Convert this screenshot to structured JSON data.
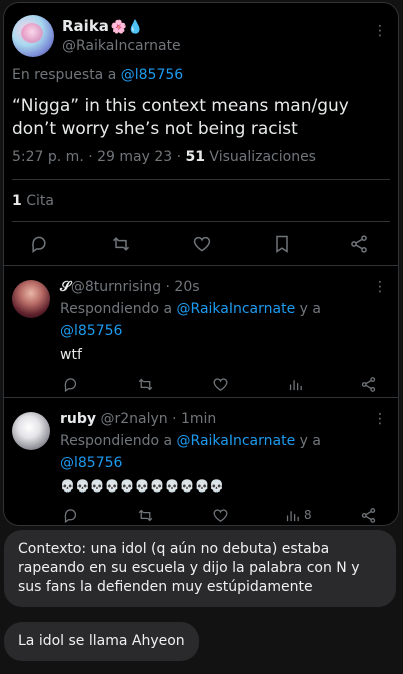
{
  "main_tweet": {
    "name": "Raika",
    "name_deco": "🌸💧",
    "handle": "@RaikaIncarnate",
    "reply_prefix": "En respuesta a ",
    "reply_target": "@l85756",
    "text": "“Nigga” in this context means man/guy don’t worry she’s not being racist",
    "time": "5:27 p. m. · 29 may 23 · ",
    "views_count": "51",
    "views_label": " Visualizaciones",
    "quotes_count": "1",
    "quotes_label": " Cita"
  },
  "replies": [
    {
      "name": "𝒮",
      "handle": "@8turnrising · 20s",
      "replying_prefix": "Respondiendo a ",
      "replying_target1": "@RaikaIncarnate",
      "replying_joiner": " y a",
      "replying_target2": "@l85756",
      "text": "wtf"
    },
    {
      "name": "ruby",
      "handle": " @r2nalyn · 1min",
      "replying_prefix": "Respondiendo a ",
      "replying_target1": "@RaikaIncarnate",
      "replying_joiner": " y a",
      "replying_target2": "@l85756",
      "text": "💀💀💀💀💀💀💀💀💀💀💀",
      "views": "8"
    }
  ],
  "messages": [
    "Contexto: una idol (q aún no debuta) estaba rapeando en su escuela y dijo la palabra con N y sus fans la defienden muy estúpidamente",
    "La idol se llama Ahyeon"
  ],
  "icons": [
    "reply-icon",
    "retweet-icon",
    "like-icon",
    "bookmark-icon",
    "share-icon",
    "views-icon",
    "more-icon"
  ],
  "colors": {
    "link": "#1d9bf0",
    "muted": "#71767b",
    "bubble": "#2a2a2c"
  }
}
